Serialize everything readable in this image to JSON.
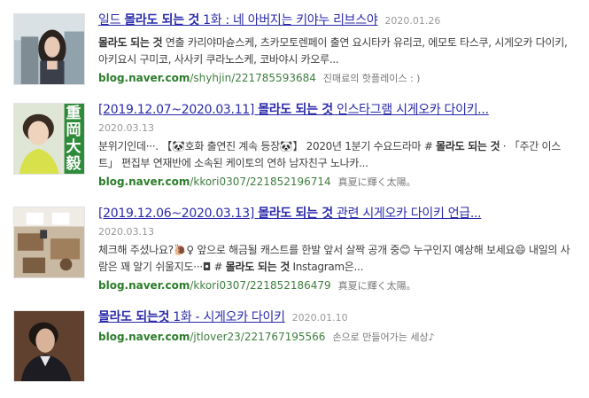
{
  "results": [
    {
      "title_prefix": "일드 ",
      "title_bold": "몰라도 되는 것",
      "title_suffix": " 1화 : 네 아버지는 키야누 리브스야",
      "date": "2020.01.26",
      "desc_bold": "몰라도 되는 것",
      "desc_rest": " 연출 카리야마슌스케, 츠카모토렌페이 출연 요시타카 유리코, 에모토 타스쿠, 시게오카 다이키, 아키요시 구미코, 사사키 쿠라노스케, 코바야시 카오루...",
      "domain": "blog.naver.com",
      "path": "/shyhjin/221785593684",
      "author": "진매료의 핫플레이스 : )",
      "thumb_icon": "woman-photo-thumbnail"
    },
    {
      "title_prefix": "[2019.12.07~2020.03.11] ",
      "title_bold": "몰라도 되는 것",
      "title_suffix": " 인스타그램 시게오카 다이키...",
      "date": "2020.03.13",
      "desc_pre": "분위기인데···.  【🐼호화 출연진 계속 등장🐼】 2020년 1분기 수요드라마 # ",
      "desc_bold": "몰라도 되는 것",
      "desc_post": " · 「주간 이스트」 편집부 연재반에 소속된 케이토의 연하 남자친구 노나카...",
      "domain": "blog.naver.com",
      "path": "/kkori0307/221852196714",
      "author": "真夏に輝く太陽。",
      "thumb_text": "重岡大毅",
      "thumb_icon": "man-photo-thumbnail"
    },
    {
      "title_prefix": "[2019.12.06~2020.03.13] ",
      "title_bold": "몰라도 되는 것",
      "title_suffix": " 관련 시게오카 다이키 언급...",
      "date": "2020.03.13",
      "desc_pre": "체크해 주셨나요?🐌♀ 앞으로 해금될 캐스트를 한발 앞서 살짝 공개 중😊 누구인지 예상해 보세요😄 내일의 사람은 꽤 알기 쉬울지도···◘ # ",
      "desc_bold": "몰라도 되는 것",
      "desc_post": " Instagram은...",
      "domain": "blog.naver.com",
      "path": "/kkori0307/221852186479",
      "author": "真夏に輝く太陽。",
      "thumb_icon": "room-photo-thumbnail"
    },
    {
      "title_prefix": "",
      "title_bold": "몰라도 되는것",
      "title_suffix": " 1화 - 시게오카 다이키",
      "date": "2020.01.10",
      "domain": "blog.naver.com",
      "path": "/jtlover23/221767195566",
      "author": "손으로 만들어가는 세상♪",
      "thumb_icon": "man-suit-photo-thumbnail"
    }
  ]
}
